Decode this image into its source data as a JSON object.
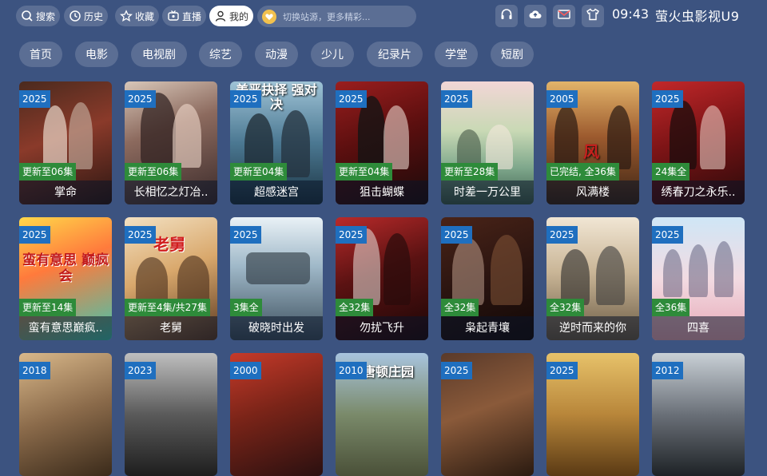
{
  "header": {
    "nav": [
      {
        "label": "搜索",
        "icon": "search-icon"
      },
      {
        "label": "历史",
        "icon": "history-icon"
      },
      {
        "label": "收藏",
        "icon": "star-icon"
      },
      {
        "label": "直播",
        "icon": "tv-icon"
      },
      {
        "label": "我的",
        "icon": "user-icon",
        "active": true
      }
    ],
    "search_placeholder": "切换站源，更多精彩...",
    "tools": [
      "headset-icon",
      "cloud-upload-icon",
      "mail-icon",
      "shirt-icon"
    ],
    "time": "09:43",
    "app_title": "萤火虫影视U9"
  },
  "categories": [
    "首页",
    "电影",
    "电视剧",
    "综艺",
    "动漫",
    "少儿",
    "纪录片",
    "学堂",
    "短剧"
  ],
  "colors": {
    "background": "#3c5380",
    "year_badge": "#1f6fbf",
    "status_badge": "#2e8b3a"
  },
  "rows": [
    [
      {
        "year": "2025",
        "status": "更新至06集",
        "title": "掌命"
      },
      {
        "year": "2025",
        "status": "更新至06集",
        "title": "长相忆之灯冶.."
      },
      {
        "year": "2025",
        "status": "更新至04集",
        "title": "超感迷宫",
        "poster_text": "美恶抉择 强对决"
      },
      {
        "year": "2025",
        "status": "更新至04集",
        "title": "狙击蝴蝶"
      },
      {
        "year": "2025",
        "status": "更新至28集",
        "title": "时差一万公里"
      },
      {
        "year": "2005",
        "status": "已完结, 全36集",
        "title": "风满楼",
        "poster_text": "风"
      },
      {
        "year": "2025",
        "status": "24集全",
        "title": "绣春刀之永乐.."
      }
    ],
    [
      {
        "year": "2025",
        "status": "更新至14集",
        "title": "蛮有意思巅疯..",
        "poster_text": "蛮有意思 巅疯会"
      },
      {
        "year": "2025",
        "status": "更新至4集/共27集",
        "title": "老舅",
        "poster_text": "老舅"
      },
      {
        "year": "2025",
        "status": "3集全",
        "title": "破晓时出发"
      },
      {
        "year": "2025",
        "status": "全32集",
        "title": "勿扰飞升"
      },
      {
        "year": "2025",
        "status": "全32集",
        "title": "枭起青壤"
      },
      {
        "year": "2025",
        "status": "全32集",
        "title": "逆时而来的你"
      },
      {
        "year": "2025",
        "status": "全36集",
        "title": "四喜"
      }
    ],
    [
      {
        "year": "2018"
      },
      {
        "year": "2023"
      },
      {
        "year": "2000"
      },
      {
        "year": "2010",
        "poster_text": "唐顿庄园"
      },
      {
        "year": "2025"
      },
      {
        "year": "2025"
      },
      {
        "year": "2012"
      }
    ]
  ]
}
